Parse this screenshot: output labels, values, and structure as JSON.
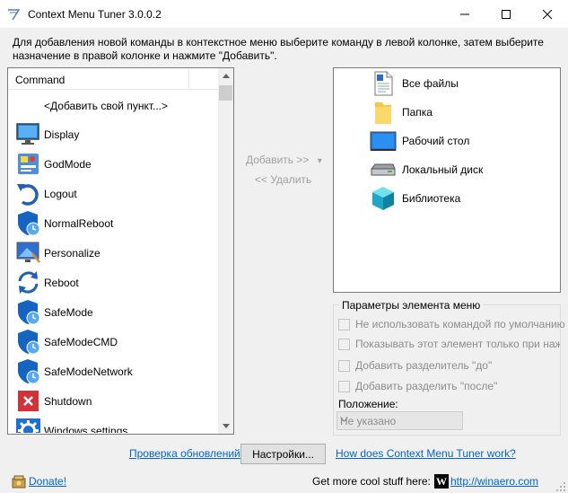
{
  "window": {
    "title": "Context Menu Tuner 3.0.0.2",
    "minimize_glyph": "—",
    "maximize_glyph": "☐",
    "close_glyph": "✕"
  },
  "instructions": "Для добавления новой команды в контекстное меню выберите команду в левой колонке, затем выберите назначение в правой колонке и нажмите \"Добавить\".",
  "commands": {
    "header": "Command",
    "items": [
      {
        "label": "<Добавить свой пункт...>",
        "icon": "none"
      },
      {
        "label": "Display",
        "icon": "display-icon"
      },
      {
        "label": "GodMode",
        "icon": "control-panel-icon"
      },
      {
        "label": "Logout",
        "icon": "logout-arrow-icon"
      },
      {
        "label": "NormalReboot",
        "icon": "shield-clock-icon"
      },
      {
        "label": "Personalize",
        "icon": "personalize-icon"
      },
      {
        "label": "Reboot",
        "icon": "refresh-icon"
      },
      {
        "label": "SafeMode",
        "icon": "shield-clock-icon"
      },
      {
        "label": "SafeModeCMD",
        "icon": "shield-clock-icon"
      },
      {
        "label": "SafeModeNetwork",
        "icon": "shield-clock-icon"
      },
      {
        "label": "Shutdown",
        "icon": "red-x-icon"
      },
      {
        "label": "Windows settings",
        "icon": "gear-icon"
      }
    ]
  },
  "middle": {
    "add_label": "Добавить >>",
    "add_dropdown_glyph": "▾",
    "remove_label": "<< Удалить"
  },
  "locations": [
    {
      "label": "Все файлы",
      "icon": "file-icon"
    },
    {
      "label": "Папка",
      "icon": "folder-icon"
    },
    {
      "label": "Рабочий стол",
      "icon": "desktop-icon"
    },
    {
      "label": "Локальный диск",
      "icon": "drive-icon"
    },
    {
      "label": "Библиотека",
      "icon": "library-icon"
    }
  ],
  "params": {
    "title": "Параметры элемента меню",
    "options": [
      "Не использовать командой по умолчанию",
      "Показывать этот элемент только при нажат",
      "Добавить разделитель \"до\"",
      "Добавить разделить \"после\""
    ],
    "position_label": "Положение:",
    "position_value": "Не указано"
  },
  "bottom": {
    "check_updates": "Проверка обновлений",
    "settings_button": "Настройки...",
    "how_link": "How does Context Menu Tuner work?",
    "donate": "Donate!",
    "cool_stuff": "Get more cool stuff here:",
    "winaero_letter": "W",
    "winaero_link": "http://winaero.com"
  },
  "colors": {
    "link": "#0066cc",
    "shield": "#1565c0",
    "disabled_text": "#8c8c8c"
  }
}
